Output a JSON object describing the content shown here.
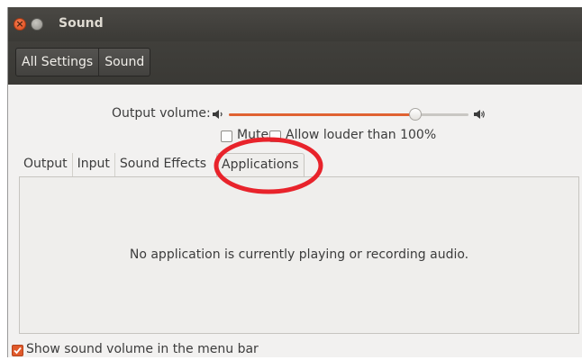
{
  "window": {
    "title": "Sound"
  },
  "toolbar": {
    "breadcrumbs": [
      "All Settings",
      "Sound"
    ]
  },
  "volume": {
    "label": "Output volume:",
    "level": 0.78,
    "accent": "#e06232"
  },
  "options": {
    "mute_label": "Mute",
    "mute_checked": false,
    "louder_label": "Allow louder than 100%",
    "louder_checked": false
  },
  "tabs": [
    {
      "label": "Output",
      "active": false
    },
    {
      "label": "Input",
      "active": false
    },
    {
      "label": "Sound Effects",
      "active": false
    },
    {
      "label": "Applications",
      "active": true
    }
  ],
  "applications_panel": {
    "empty_message": "No application is currently playing or recording audio."
  },
  "footer": {
    "show_in_menu_bar_label": "Show sound volume in the menu bar",
    "show_in_menu_bar_checked": true
  },
  "annotation": {
    "shape": "ellipse",
    "color": "#e8232b",
    "target": "Applications"
  },
  "icons": {
    "close": "close-icon",
    "minimize": "minimize-icon",
    "speaker_low": "speaker-low-icon",
    "speaker_high": "speaker-high-icon",
    "checkmark": "checkmark-icon"
  }
}
